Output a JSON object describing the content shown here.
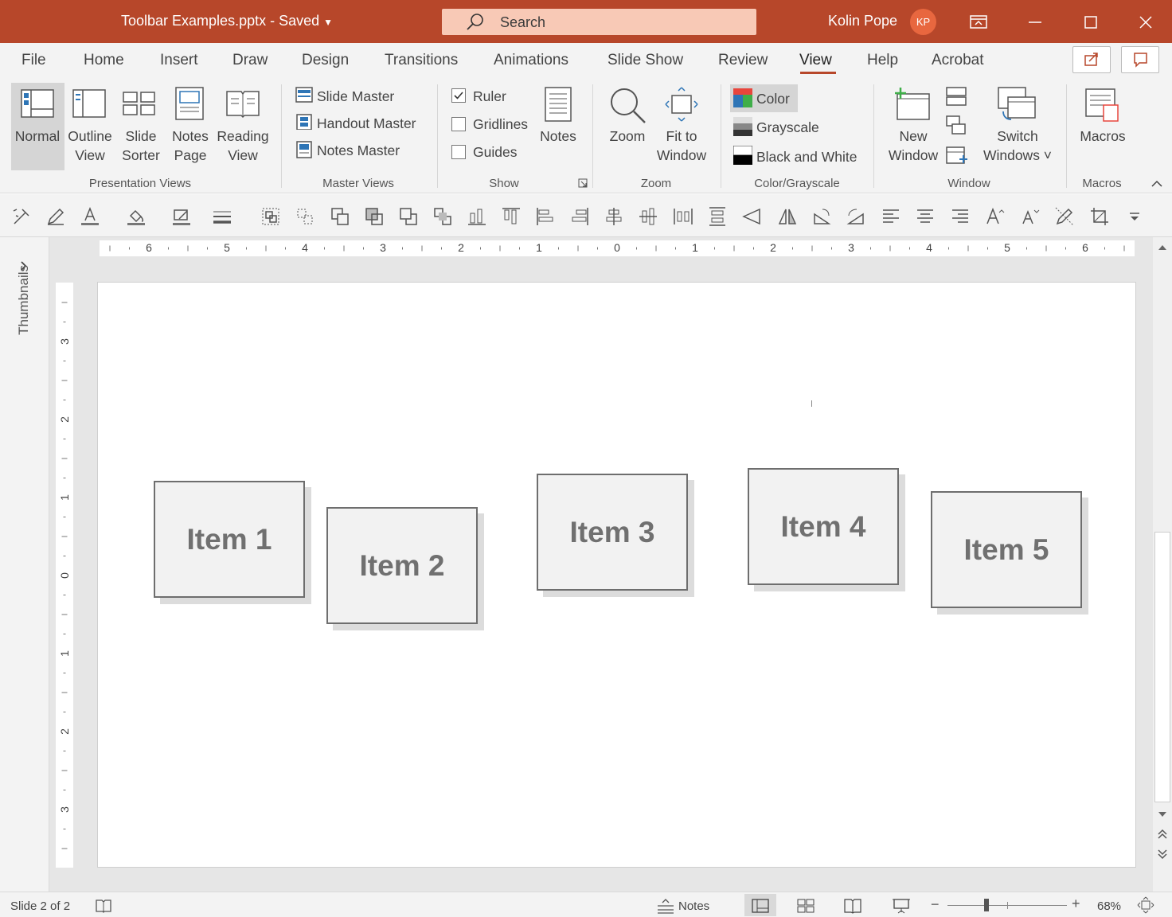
{
  "title_bar": {
    "document_title": "Toolbar Examples.pptx  -  Saved",
    "search_placeholder": "Search",
    "user_name": "Kolin Pope",
    "user_initials": "KP"
  },
  "menu": {
    "tabs": [
      "File",
      "Home",
      "Insert",
      "Draw",
      "Design",
      "Transitions",
      "Animations",
      "Slide Show",
      "Review",
      "View",
      "Help",
      "Acrobat"
    ],
    "active_tab": "View",
    "accent_color": "#b7472a"
  },
  "ribbon": {
    "presentation_views": {
      "normal": "Normal",
      "outline_view": [
        "Outline",
        "View"
      ],
      "slide_sorter": [
        "Slide",
        "Sorter"
      ],
      "notes_page": [
        "Notes",
        "Page"
      ],
      "reading_view": [
        "Reading",
        "View"
      ],
      "group": "Presentation Views"
    },
    "master_views": {
      "slide_master": "Slide Master",
      "handout_master": "Handout Master",
      "notes_master": "Notes Master",
      "group": "Master Views"
    },
    "show": {
      "ruler": "Ruler",
      "ruler_checked": true,
      "gridlines": "Gridlines",
      "gridlines_checked": false,
      "guides": "Guides",
      "guides_checked": false,
      "notes": "Notes",
      "group": "Show"
    },
    "zoom": {
      "zoom": "Zoom",
      "fit_to_window": [
        "Fit to",
        "Window"
      ],
      "group": "Zoom"
    },
    "color_grayscale": {
      "color": "Color",
      "grayscale": "Grayscale",
      "black_and_white": "Black and White",
      "group": "Color/Grayscale"
    },
    "window": {
      "new_window": [
        "New",
        "Window"
      ],
      "switch_windows": [
        "Switch",
        "Windows ˅"
      ],
      "group": "Window"
    },
    "macros": {
      "macros": "Macros",
      "group": "Macros"
    }
  },
  "thumbnails_label": "Thumbnails",
  "ruler": {
    "h_labels": [
      "6",
      "5",
      "4",
      "3",
      "2",
      "1",
      "0",
      "1",
      "2",
      "3",
      "4",
      "5",
      "6"
    ],
    "v_labels": [
      "3",
      "2",
      "1",
      "0",
      "1",
      "2",
      "3"
    ]
  },
  "slide": {
    "items": [
      "Item 1",
      "Item 2",
      "Item 3",
      "Item 4",
      "Item 5"
    ]
  },
  "status": {
    "slide_counter": "Slide 2 of 2",
    "notes": "Notes",
    "zoom": "68%",
    "zoom_level": 0.68
  }
}
